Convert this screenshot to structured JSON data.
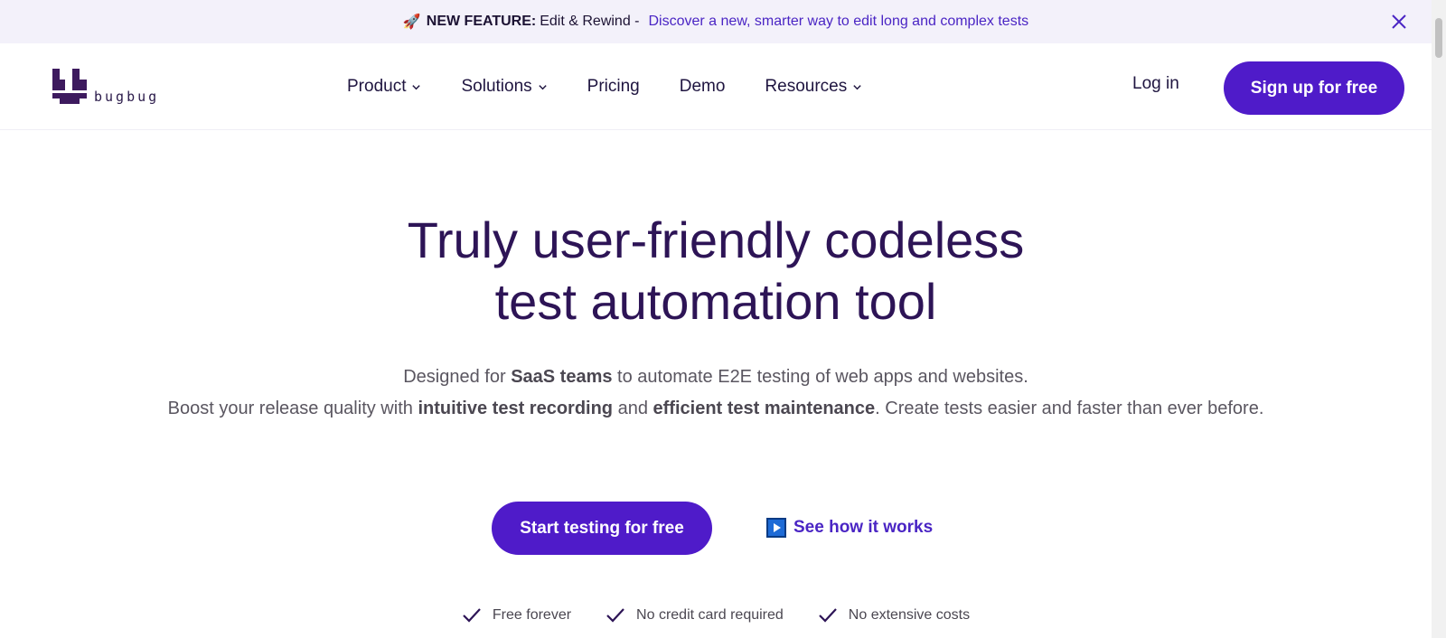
{
  "banner": {
    "icon": "rocket-icon",
    "strong": "NEW FEATURE:",
    "plain": "Edit & Rewind -",
    "link": "Discover a new, smarter way to edit long and complex tests",
    "close_icon": "close-icon"
  },
  "nav": {
    "logo_text": "bugbug",
    "items": [
      {
        "label": "Product",
        "dropdown": true
      },
      {
        "label": "Solutions",
        "dropdown": true
      },
      {
        "label": "Pricing",
        "dropdown": false
      },
      {
        "label": "Demo",
        "dropdown": false
      },
      {
        "label": "Resources",
        "dropdown": true
      }
    ],
    "login": "Log in",
    "signup": "Sign up for free"
  },
  "hero": {
    "title_line1": "Truly user-friendly codeless",
    "title_line2": "test automation tool",
    "sub": [
      {
        "t": "Designed for ",
        "b": false
      },
      {
        "t": "SaaS teams",
        "b": true
      },
      {
        "t": " to automate E2E testing of web apps and websites.",
        "b": false
      },
      {
        "t": "Boost your release quality with ",
        "b": false
      },
      {
        "t": "intuitive test recording",
        "b": true
      },
      {
        "t": " and ",
        "b": false
      },
      {
        "t": "efficient test maintenance",
        "b": true
      },
      {
        "t": ". Create tests easier and faster than ever before.",
        "b": false
      }
    ],
    "cta": "Start testing for free",
    "how": "See how it works",
    "perks": [
      "Free forever",
      "No credit card required",
      "No extensive costs"
    ]
  },
  "colors": {
    "brand": "#4f1bc9",
    "title": "#2d1456",
    "banner_bg": "#f3f1fa"
  }
}
